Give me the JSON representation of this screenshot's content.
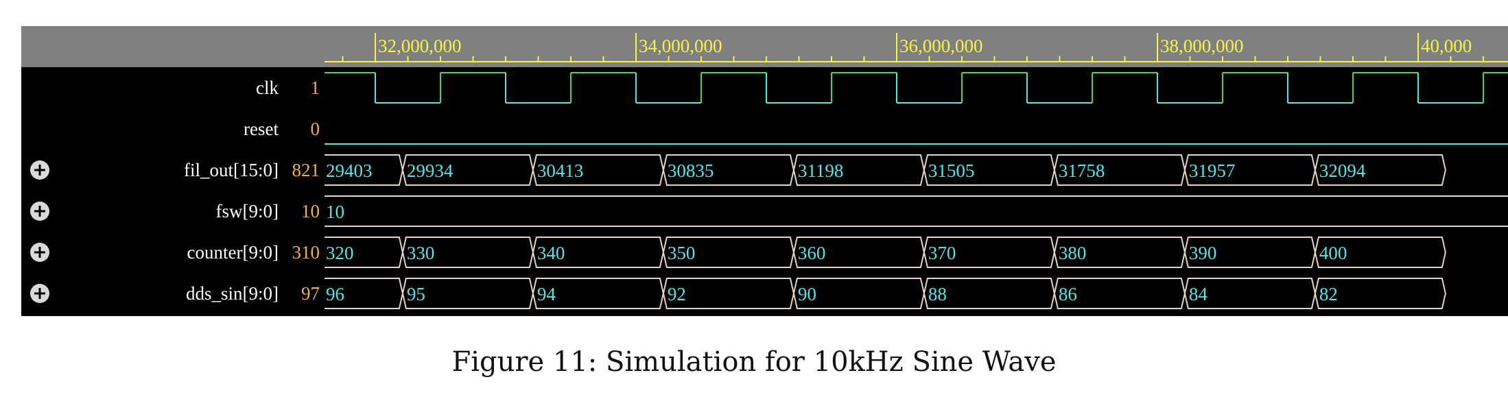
{
  "waveform": {
    "time_ticks": [
      {
        "label": "32,000,000",
        "time": 32000000
      },
      {
        "label": "34,000,000",
        "time": 34000000
      },
      {
        "label": "36,000,000",
        "time": 36000000
      },
      {
        "label": "38,000,000",
        "time": 38000000
      },
      {
        "label": "40,000",
        "time": 40000000
      }
    ],
    "view_start_time": 31640000,
    "clock_half_period": 500000,
    "signals": [
      {
        "name": "clk",
        "cursor_value": "1",
        "type": "clock",
        "expandable": false,
        "first_level": 1
      },
      {
        "name": "reset",
        "cursor_value": "0",
        "type": "level",
        "expandable": false,
        "level": 0
      },
      {
        "name": "fil_out[15:0]",
        "cursor_value": "821",
        "type": "bus",
        "expandable": true,
        "segments": [
          "29403",
          "29934",
          "30413",
          "30835",
          "31198",
          "31505",
          "31758",
          "31957",
          "32094"
        ]
      },
      {
        "name": "fsw[9:0]",
        "cursor_value": "10",
        "type": "bus",
        "expandable": true,
        "segments": [
          "10"
        ]
      },
      {
        "name": "counter[9:0]",
        "cursor_value": "310",
        "type": "bus",
        "expandable": true,
        "segments": [
          "320",
          "330",
          "340",
          "350",
          "360",
          "370",
          "380",
          "390",
          "400"
        ]
      },
      {
        "name": "dds_sin[9:0]",
        "cursor_value": "97",
        "type": "bus",
        "expandable": true,
        "segments": [
          "96",
          "95",
          "94",
          "92",
          "90",
          "88",
          "86",
          "84",
          "82"
        ]
      }
    ],
    "colors": {
      "ruler_bg": "#808080",
      "ruler_fg": "#f5f542",
      "clock_high": "#3fd94a",
      "clock_low": "#4fe8e8",
      "bus_outline": "#e6d4bf",
      "bus_text": "#4fe8e8",
      "value_text": "#f2b13c",
      "name_text": "#ffffff"
    }
  },
  "caption": "Figure 11: Simulation for 10kHz Sine Wave"
}
